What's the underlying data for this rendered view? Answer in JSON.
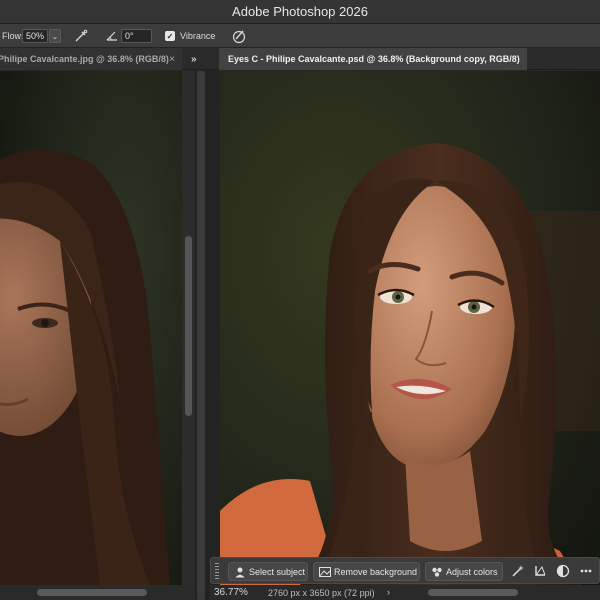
{
  "app": {
    "title": "Adobe Photoshop 2026"
  },
  "options_bar": {
    "flow_label": "Flow:",
    "flow_value": "50%",
    "angle_value": "0°",
    "vibrance_label": "Vibrance",
    "vibrance_checked": true,
    "icons": [
      "airbrush-icon",
      "angle-icon",
      "pressure-icon"
    ]
  },
  "tabs": {
    "inactive": {
      "label": "Philipe Cavalcante.jpg @ 36.8% (RGB/8)"
    },
    "active": {
      "label": "Eyes C - Philipe Cavalcante.psd @ 36.8% (Background copy, RGB/8)"
    },
    "overflow_label": "»",
    "close_label": "×"
  },
  "taskbar": {
    "select_subject": "Select subject",
    "remove_background": "Remove background",
    "adjust_colors": "Adjust colors",
    "icons": [
      "magic-wand-icon",
      "crop-transform-icon",
      "adjustment-layer-icon",
      "more-options-icon"
    ]
  },
  "status": {
    "zoom": "36.77%",
    "dimensions": "2760 px x 3650 px (72 ppi)",
    "arrow": "›"
  },
  "colors": {
    "ui_dark": "#282828",
    "titlebar": "#353535",
    "active_tab": "#424242",
    "skin": "#b07a5c",
    "hair": "#3a2418",
    "shirt": "#d96a3c"
  }
}
